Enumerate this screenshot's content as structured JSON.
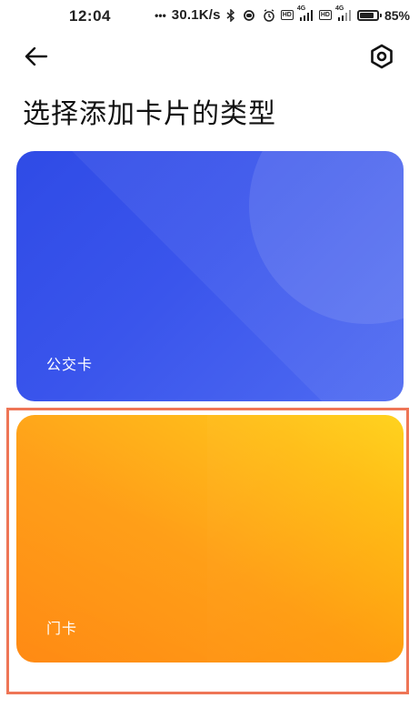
{
  "status_bar": {
    "time": "12:04",
    "network_speed": "30.1K/s",
    "battery_percent": "85%",
    "battery_level": 0.85,
    "net_type_1": "4G",
    "net_type_2": "4G",
    "hd_1": "HD",
    "hd_2": "HD",
    "icons": [
      "bluetooth-icon",
      "vibrate-icon",
      "alarm-icon",
      "hd-icon",
      "signal-icon",
      "hd-icon",
      "signal-icon",
      "battery-icon"
    ]
  },
  "header": {
    "back_icon": "arrow-left-icon",
    "settings_icon": "hexagon-settings-icon",
    "title": "选择添加卡片的类型"
  },
  "cards": [
    {
      "label": "公交卡",
      "color": "#3a55ec"
    },
    {
      "label": "门卡",
      "color": "#ffa010"
    }
  ],
  "selection": {
    "selected_card_index": 1,
    "highlight_color": "#ee7556"
  }
}
